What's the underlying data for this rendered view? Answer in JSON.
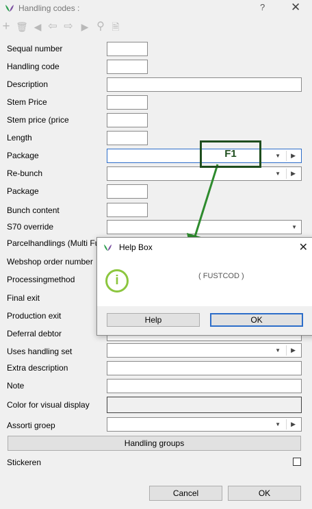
{
  "window": {
    "title": "Handling codes :",
    "help_glyph": "?",
    "close_glyph": "✕"
  },
  "toolbar": {
    "icons": [
      "add-icon",
      "delete-icon",
      "first-record-icon",
      "previous-record-icon",
      "next-record-icon",
      "last-record-icon",
      "search-icon",
      "document-icon"
    ],
    "glyphs": [
      "+",
      "🗑",
      "◀",
      "⇦",
      "⇨",
      "▶",
      "⚲",
      "🗎"
    ]
  },
  "form": {
    "fields": [
      {
        "label": "Sequal number",
        "value": ""
      },
      {
        "label": "Handling code",
        "value": ""
      },
      {
        "label": "Description",
        "value": ""
      },
      {
        "label": "Stem Price",
        "value": ""
      },
      {
        "label": "Stem price (price",
        "value": ""
      },
      {
        "label": "Length",
        "value": ""
      },
      {
        "label": "Package",
        "value": ""
      },
      {
        "label": "Re-bunch",
        "value": ""
      },
      {
        "label": "Package",
        "value": ""
      },
      {
        "label": "Bunch content",
        "value": ""
      },
      {
        "label": "S70 override",
        "value": ""
      },
      {
        "label": "Parcelhandlings (Multi Fu",
        "value": ""
      },
      {
        "label": "Webshop order number",
        "value": ""
      },
      {
        "label": "Processingmethod",
        "value": ""
      },
      {
        "label": "Final exit",
        "value": ""
      },
      {
        "label": "Production exit",
        "value": ""
      },
      {
        "label": "Deferral debtor",
        "value": ""
      },
      {
        "label": "Uses handling set",
        "value": ""
      },
      {
        "label": "Extra description",
        "value": ""
      },
      {
        "label": "Note",
        "value": ""
      },
      {
        "label": "Color for visual display",
        "value": ""
      },
      {
        "label": "Assorti groep",
        "value": ""
      }
    ],
    "handling_groups_label": "Handling groups",
    "stickeren_label": "Stickeren",
    "stickeren_checked": false,
    "dropdown_glyph": "▼",
    "arrow_glyph": "▶"
  },
  "footer": {
    "cancel_label": "Cancel",
    "ok_label": "OK"
  },
  "annotation": {
    "label": "F1",
    "color": "#1e4d1e",
    "arrow_color": "#2e8b2e"
  },
  "help_box": {
    "title": "Help Box",
    "close_glyph": "✕",
    "info_glyph": "i",
    "message": "( FUSTCOD )",
    "help_label": "Help",
    "ok_label": "OK"
  },
  "colors": {
    "accent": "#2c6dc9",
    "info_green": "#8cc63f",
    "logo_green": "#2e9e4f",
    "logo_purple": "#7b4fa0"
  }
}
